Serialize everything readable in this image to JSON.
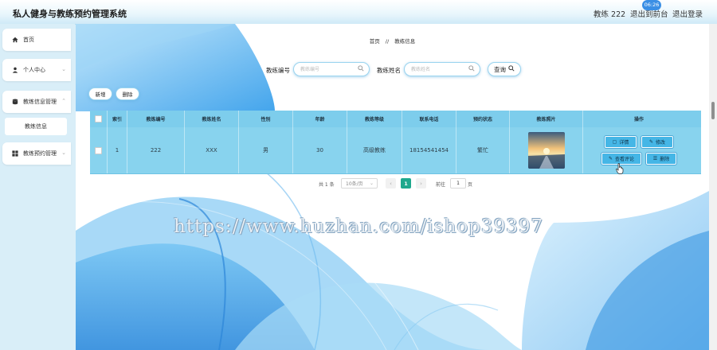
{
  "header": {
    "title": "私人健身与教练预约管理系统",
    "user": "教练 222",
    "back_label": "退出到前台",
    "logout_label": "退出登录",
    "time_badge": "06:26"
  },
  "sidebar": {
    "items": [
      {
        "label": "首页",
        "icon": "home-icon"
      },
      {
        "label": "个人中心",
        "icon": "user-icon"
      },
      {
        "label": "教练信息管理",
        "icon": "database-icon"
      },
      {
        "label": "教练信息"
      },
      {
        "label": "教练预约管理",
        "icon": "grid-icon"
      }
    ]
  },
  "breadcrumb": {
    "home": "首页",
    "separator": "//",
    "current": "教练信息"
  },
  "search": {
    "field1_label": "教练编号",
    "field1_placeholder": "教练编号",
    "field2_label": "教练姓名",
    "field2_placeholder": "教练姓名",
    "query_label": "查询"
  },
  "actions": {
    "add": "新增",
    "delete": "删除"
  },
  "table": {
    "columns": [
      "索引",
      "教练编号",
      "教练姓名",
      "性别",
      "年龄",
      "教练等级",
      "联系电话",
      "预约状态",
      "教练照片",
      "操作"
    ],
    "rows": [
      {
        "index": "1",
        "code": "222",
        "name": "XXX",
        "gender": "男",
        "age": "30",
        "level": "高级教练",
        "phone": "18154541454",
        "status": "繁忙"
      }
    ],
    "row_actions": {
      "detail": "详情",
      "edit": "修改",
      "review": "查看评论",
      "delete": "删除"
    }
  },
  "pagination": {
    "total": "共 1 条",
    "page_size": "10条/页",
    "current_page": "1",
    "goto_label": "前往",
    "goto_value": "1",
    "page_suffix": "页"
  },
  "watermark": "https://www.huzhan.com/ishop39397",
  "colors": {
    "accent": "#45b6e6",
    "table_header": "#7dcdec",
    "page_active": "#1fa88d"
  }
}
